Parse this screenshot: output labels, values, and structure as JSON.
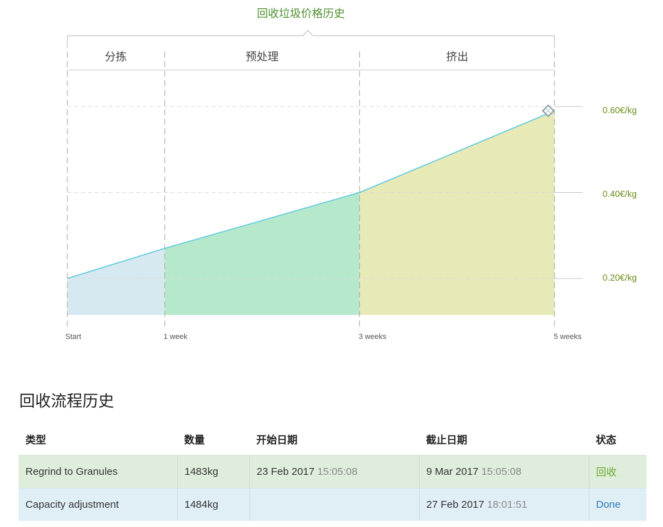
{
  "chart": {
    "title": "回收垃圾价格历史",
    "phases": [
      "分拣",
      "预处理",
      "挤出"
    ],
    "y_labels": [
      "0.60€/kg",
      "0.40€/kg",
      "0.20€/kg"
    ],
    "x_labels": [
      "Start",
      "1 week",
      "3 weeks",
      "5 weeks"
    ]
  },
  "chart_data": {
    "type": "area",
    "title": "回收垃圾价格历史",
    "x": [
      0,
      1,
      3,
      5
    ],
    "x_tick_labels": [
      "Start",
      "1 week",
      "3 weeks",
      "5 weeks"
    ],
    "values": [
      0.2,
      0.27,
      0.4,
      0.59
    ],
    "ylim": [
      0.115,
      0.685
    ],
    "y_ticks": [
      0.2,
      0.4,
      0.6
    ],
    "y_tick_labels": [
      "0.20€/kg",
      "0.40€/kg",
      "0.60€/kg"
    ],
    "phases": [
      {
        "name": "分拣",
        "from": 0,
        "to": 1,
        "color": "#d7e9f0"
      },
      {
        "name": "预处理",
        "from": 1,
        "to": 3,
        "color": "#b6e9cc"
      },
      {
        "name": "挤出",
        "from": 3,
        "to": 5,
        "color": "#e7eab6"
      }
    ],
    "line_color": "#5bc8e0",
    "grid": true
  },
  "section": {
    "title": "回收流程历史"
  },
  "table": {
    "headers": [
      "类型",
      "数量",
      "开始日期",
      "截止日期",
      "状态"
    ],
    "rows": [
      {
        "type": "Regrind to Granules",
        "qty": "1483kg",
        "start_date": "23 Feb 2017",
        "start_time": "15:05:08",
        "end_date": "9 Mar 2017",
        "end_time": "15:05:08",
        "status": "回收"
      },
      {
        "type": "Capacity adjustment",
        "qty": "1484kg",
        "start_date": "",
        "start_time": "",
        "end_date": "27 Feb 2017",
        "end_time": "18:01:51",
        "status": "Done"
      }
    ]
  }
}
